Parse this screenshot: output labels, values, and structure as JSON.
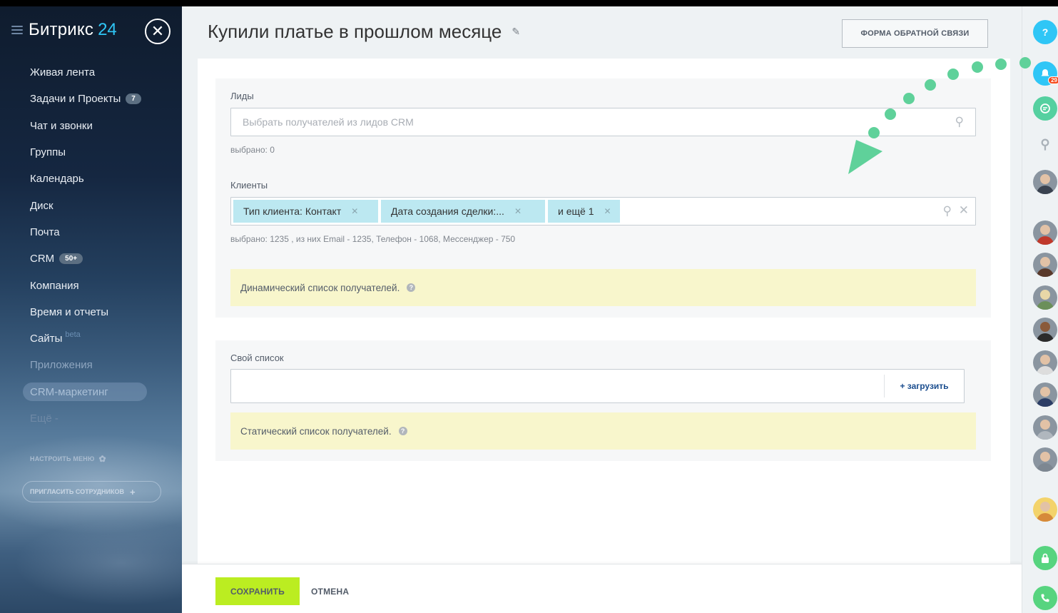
{
  "sidebar": {
    "logo": {
      "name": "Битрикс",
      "num": "24"
    },
    "close_icon": "close-icon",
    "items": [
      {
        "label": "Живая лента"
      },
      {
        "label": "Задачи и Проекты",
        "counter": "7"
      },
      {
        "label": "Чат и звонки"
      },
      {
        "label": "Группы"
      },
      {
        "label": "Календарь"
      },
      {
        "label": "Диск"
      },
      {
        "label": "Почта"
      },
      {
        "label": "CRM",
        "counter": "50+"
      },
      {
        "label": "Компания"
      },
      {
        "label": "Время и отчеты"
      },
      {
        "label": "Сайты",
        "beta": "beta"
      },
      {
        "label": "Приложения"
      },
      {
        "label": "CRM-маркетинг"
      },
      {
        "label": "Ещё -"
      }
    ],
    "setup_menu": "НАСТРОИТЬ МЕНЮ",
    "invite": "ПРИГЛАСИТЬ СОТРУДНИКОВ"
  },
  "header": {
    "title": "Купили платье в прошлом месяце",
    "feedback_button": "ФОРМА ОБРАТНОЙ СВЯЗИ"
  },
  "leads": {
    "label": "Лиды",
    "placeholder": "Выбрать получателей из лидов CRM",
    "selected": "выбрано:  0"
  },
  "clients": {
    "label": "Клиенты",
    "tags": [
      "Тип клиента: Контакт",
      "Дата создания сделки:...",
      "и ещё 1"
    ],
    "selected": "выбрано:  1235 , из них Email - 1235, Телефон - 1068, Мессенджер - 750",
    "note": "Динамический список получателей."
  },
  "own_list": {
    "label": "Свой список",
    "upload": "+ загрузить",
    "note": "Статический список получателей."
  },
  "footer": {
    "save": "СОХРАНИТЬ",
    "cancel": "ОТМЕНА"
  },
  "rightbar": {
    "help": "?",
    "notifications_badge": "29"
  },
  "colors": {
    "accent": "#2fc6f6",
    "save": "#bbed21",
    "tag": "#bce8f1",
    "note": "#f8f6cc",
    "arrow": "#5fd19a"
  }
}
